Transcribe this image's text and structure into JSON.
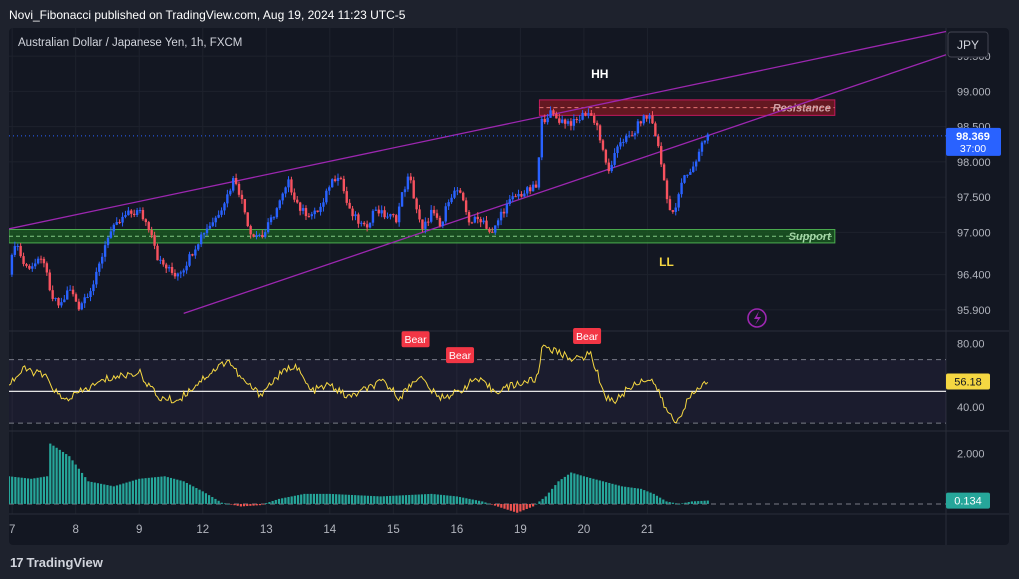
{
  "header": {
    "published": "Novi_Fibonacci published on TradingView.com, Aug 19, 2024 11:23 UTC-5"
  },
  "symbol": "Australian Dollar / Japanese Yen, 1h, FXCM",
  "currency_button": "JPY",
  "footer": {
    "brand": "TradingView",
    "logo_glyph": "17"
  },
  "colors": {
    "up": "#2962ff",
    "down": "#f7525f",
    "trend": "#9c27b0",
    "support_fill": "#1b5e20",
    "resistance_fill": "#801922",
    "rsi_line": "#f5d742",
    "hist_pos": "#26a69a",
    "hist_neg": "#ef5350"
  },
  "chart_data": [
    {
      "type": "candlestick",
      "title": "Australian Dollar / Japanese Yen, 1h, FXCM",
      "x_ticks": [
        "7",
        "8",
        "9",
        "12",
        "13",
        "14",
        "15",
        "16",
        "19",
        "20",
        "21"
      ],
      "y_ticks": [
        "99.500",
        "99.000",
        "98.500",
        "98.000",
        "97.500",
        "97.000",
        "96.400",
        "95.900"
      ],
      "ylim": [
        95.6,
        99.9
      ],
      "last_price": "98.369",
      "countdown": "37:00",
      "annotations": [
        "HH",
        "LL",
        "Resistance",
        "Support"
      ],
      "zones": [
        {
          "label": "Resistance",
          "from_day": 15.3,
          "to_day": 19.95,
          "low": 98.66,
          "high": 98.88
        },
        {
          "label": "Support",
          "from_day": 6.95,
          "to_day": 19.95,
          "low": 96.85,
          "high": 97.04
        }
      ],
      "trendlines": [
        {
          "from": [
            6.95,
            97.05
          ],
          "to": [
            21.7,
            99.85
          ]
        },
        {
          "from": [
            9.7,
            95.85
          ],
          "to": [
            21.7,
            99.52
          ]
        }
      ],
      "price_path_anchors": [
        {
          "day": 6.95,
          "price": 96.4
        },
        {
          "day": 7.05,
          "price": 96.9
        },
        {
          "day": 7.2,
          "price": 96.5
        },
        {
          "day": 7.5,
          "price": 96.6
        },
        {
          "day": 7.6,
          "price": 96.1
        },
        {
          "day": 7.75,
          "price": 95.95
        },
        {
          "day": 7.9,
          "price": 96.2
        },
        {
          "day": 8.05,
          "price": 95.95
        },
        {
          "day": 8.3,
          "price": 96.3
        },
        {
          "day": 8.5,
          "price": 96.95
        },
        {
          "day": 8.8,
          "price": 97.25
        },
        {
          "day": 9.0,
          "price": 97.3
        },
        {
          "day": 9.2,
          "price": 97.0
        },
        {
          "day": 9.3,
          "price": 96.6
        },
        {
          "day": 9.55,
          "price": 96.4
        },
        {
          "day": 9.7,
          "price": 96.5
        },
        {
          "day": 10.0,
          "price": 97.0
        },
        {
          "day": 10.2,
          "price": 97.2
        },
        {
          "day": 10.4,
          "price": 97.55
        },
        {
          "day": 10.5,
          "price": 97.8
        },
        {
          "day": 10.6,
          "price": 97.5
        },
        {
          "day": 10.75,
          "price": 97.0
        },
        {
          "day": 10.95,
          "price": 96.95
        },
        {
          "day": 11.2,
          "price": 97.4
        },
        {
          "day": 11.35,
          "price": 97.7
        },
        {
          "day": 11.55,
          "price": 97.3
        },
        {
          "day": 11.75,
          "price": 97.25
        },
        {
          "day": 11.9,
          "price": 97.4
        },
        {
          "day": 12.0,
          "price": 97.7
        },
        {
          "day": 12.15,
          "price": 97.85
        },
        {
          "day": 12.3,
          "price": 97.3
        },
        {
          "day": 12.45,
          "price": 97.15
        },
        {
          "day": 12.55,
          "price": 97.05
        },
        {
          "day": 12.72,
          "price": 97.35
        },
        {
          "day": 12.83,
          "price": 97.25
        },
        {
          "day": 13.05,
          "price": 97.2
        },
        {
          "day": 13.15,
          "price": 97.58
        },
        {
          "day": 13.25,
          "price": 97.8
        },
        {
          "day": 13.32,
          "price": 97.52
        },
        {
          "day": 13.45,
          "price": 97.0
        },
        {
          "day": 13.6,
          "price": 97.3
        },
        {
          "day": 13.75,
          "price": 97.05
        },
        {
          "day": 13.88,
          "price": 97.52
        },
        {
          "day": 14.02,
          "price": 97.6
        },
        {
          "day": 14.2,
          "price": 97.15
        },
        {
          "day": 14.4,
          "price": 97.2
        },
        {
          "day": 14.55,
          "price": 96.95
        },
        {
          "day": 14.7,
          "price": 97.28
        },
        {
          "day": 14.9,
          "price": 97.5
        },
        {
          "day": 15.1,
          "price": 97.58
        },
        {
          "day": 15.27,
          "price": 97.65
        },
        {
          "day": 15.32,
          "price": 98.55
        },
        {
          "day": 15.45,
          "price": 98.7
        },
        {
          "day": 15.6,
          "price": 98.6
        },
        {
          "day": 15.85,
          "price": 98.55
        },
        {
          "day": 16.05,
          "price": 98.72
        },
        {
          "day": 16.2,
          "price": 98.55
        },
        {
          "day": 16.33,
          "price": 98.0
        },
        {
          "day": 16.42,
          "price": 97.85
        },
        {
          "day": 16.55,
          "price": 98.3
        },
        {
          "day": 16.75,
          "price": 98.35
        },
        {
          "day": 16.9,
          "price": 98.6
        },
        {
          "day": 17.05,
          "price": 98.65
        },
        {
          "day": 17.15,
          "price": 98.3
        },
        {
          "day": 17.28,
          "price": 97.65
        },
        {
          "day": 17.38,
          "price": 97.2
        },
        {
          "day": 17.48,
          "price": 97.45
        },
        {
          "day": 17.55,
          "price": 97.75
        },
        {
          "day": 17.72,
          "price": 97.92
        },
        {
          "day": 17.85,
          "price": 98.25
        },
        {
          "day": 17.95,
          "price": 98.369
        }
      ]
    },
    {
      "type": "line",
      "title": "",
      "y_ticks": [
        "80.00",
        "40.00"
      ],
      "ylim": [
        25,
        88
      ],
      "levels": [
        70,
        30
      ],
      "mid_level": 50,
      "last_value": "56.18",
      "labels": [
        "Bear",
        "Bear",
        "Bear"
      ],
      "value_anchors": [
        {
          "day": 6.95,
          "value": 55
        },
        {
          "day": 7.2,
          "value": 64
        },
        {
          "day": 7.5,
          "value": 60
        },
        {
          "day": 7.8,
          "value": 44
        },
        {
          "day": 8.1,
          "value": 50
        },
        {
          "day": 8.5,
          "value": 58
        },
        {
          "day": 9.0,
          "value": 62
        },
        {
          "day": 9.3,
          "value": 46
        },
        {
          "day": 9.6,
          "value": 44
        },
        {
          "day": 10.0,
          "value": 58
        },
        {
          "day": 10.4,
          "value": 70
        },
        {
          "day": 10.6,
          "value": 58
        },
        {
          "day": 10.9,
          "value": 48
        },
        {
          "day": 11.2,
          "value": 60
        },
        {
          "day": 11.45,
          "value": 67
        },
        {
          "day": 11.7,
          "value": 50
        },
        {
          "day": 12.0,
          "value": 54
        },
        {
          "day": 12.3,
          "value": 46
        },
        {
          "day": 12.6,
          "value": 52
        },
        {
          "day": 12.85,
          "value": 56
        },
        {
          "day": 13.1,
          "value": 46
        },
        {
          "day": 13.4,
          "value": 60
        },
        {
          "day": 13.7,
          "value": 46
        },
        {
          "day": 14.0,
          "value": 49
        },
        {
          "day": 14.3,
          "value": 58
        },
        {
          "day": 14.6,
          "value": 50
        },
        {
          "day": 14.9,
          "value": 54
        },
        {
          "day": 15.27,
          "value": 58
        },
        {
          "day": 15.35,
          "value": 80
        },
        {
          "day": 15.6,
          "value": 74
        },
        {
          "day": 15.9,
          "value": 70
        },
        {
          "day": 16.1,
          "value": 74
        },
        {
          "day": 16.35,
          "value": 46
        },
        {
          "day": 16.5,
          "value": 44
        },
        {
          "day": 16.7,
          "value": 52
        },
        {
          "day": 16.95,
          "value": 58
        },
        {
          "day": 17.1,
          "value": 56
        },
        {
          "day": 17.3,
          "value": 38
        },
        {
          "day": 17.45,
          "value": 30
        },
        {
          "day": 17.6,
          "value": 42
        },
        {
          "day": 17.8,
          "value": 52
        },
        {
          "day": 17.95,
          "value": 56.18
        }
      ]
    },
    {
      "type": "histogram",
      "title": "",
      "y_ticks": [
        "2.000"
      ],
      "ylim": [
        -0.4,
        2.9
      ],
      "zero_level": 0,
      "last_value": "0.134",
      "value_anchors": [
        {
          "day": 6.95,
          "value": 1.1
        },
        {
          "day": 7.3,
          "value": 1.0
        },
        {
          "day": 7.55,
          "value": 1.1
        },
        {
          "day": 7.6,
          "value": 2.4
        },
        {
          "day": 7.9,
          "value": 1.9
        },
        {
          "day": 8.2,
          "value": 0.9
        },
        {
          "day": 8.6,
          "value": 0.7
        },
        {
          "day": 9.0,
          "value": 1.0
        },
        {
          "day": 9.4,
          "value": 1.1
        },
        {
          "day": 9.7,
          "value": 0.9
        },
        {
          "day": 10.0,
          "value": 0.5
        },
        {
          "day": 10.3,
          "value": 0.05
        },
        {
          "day": 10.6,
          "value": -0.1
        },
        {
          "day": 10.9,
          "value": -0.05
        },
        {
          "day": 11.2,
          "value": 0.2
        },
        {
          "day": 11.6,
          "value": 0.4
        },
        {
          "day": 12.0,
          "value": 0.4
        },
        {
          "day": 12.4,
          "value": 0.35
        },
        {
          "day": 12.8,
          "value": 0.3
        },
        {
          "day": 13.2,
          "value": 0.35
        },
        {
          "day": 13.6,
          "value": 0.4
        },
        {
          "day": 14.0,
          "value": 0.3
        },
        {
          "day": 14.4,
          "value": 0.1
        },
        {
          "day": 14.7,
          "value": -0.15
        },
        {
          "day": 14.95,
          "value": -0.35
        },
        {
          "day": 15.2,
          "value": -0.1
        },
        {
          "day": 15.4,
          "value": 0.3
        },
        {
          "day": 15.6,
          "value": 0.9
        },
        {
          "day": 15.8,
          "value": 1.25
        },
        {
          "day": 16.0,
          "value": 1.1
        },
        {
          "day": 16.3,
          "value": 0.9
        },
        {
          "day": 16.6,
          "value": 0.7
        },
        {
          "day": 16.9,
          "value": 0.6
        },
        {
          "day": 17.1,
          "value": 0.4
        },
        {
          "day": 17.3,
          "value": 0.1
        },
        {
          "day": 17.5,
          "value": 0.0
        },
        {
          "day": 17.7,
          "value": 0.1
        },
        {
          "day": 17.95,
          "value": 0.134
        }
      ]
    }
  ]
}
